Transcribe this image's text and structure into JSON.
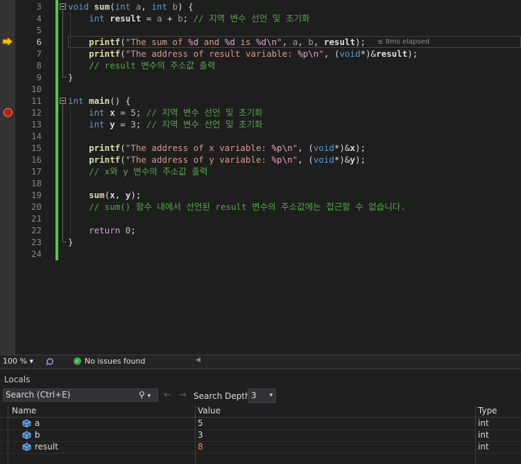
{
  "editor": {
    "lines": [
      {
        "n": "3",
        "html": "<span class='kw'>void</span> <span class='fn'>sum</span>(<span class='kw'>int</span> <span class='pm'>a</span>, <span class='kw'>int</span> <span class='pm'>b</span>) {"
      },
      {
        "n": "4",
        "html": "    <span class='kw'>int</span> <span class='bold'>result</span> = <span class='pm'>a</span> + <span class='pm'>b</span>; <span class='cm'>// 지역 변수 선언 및 초기화</span>"
      },
      {
        "n": "5",
        "html": ""
      },
      {
        "n": "6",
        "html": "    <span class='fn'>printf</span>(<span class='str'>\"The sum of </span><span class='fmt'>%d</span><span class='str'> and </span><span class='fmt'>%d</span><span class='str'> is </span><span class='fmt'>%d\\n</span><span class='str'>\"</span>, <span class='pm'>a</span>, <span class='pm'>b</span>, <span class='bold'>result</span>);"
      },
      {
        "n": "7",
        "html": "    <span class='fn'>printf</span>(<span class='str'>\"The address of result variable: </span><span class='fmt'>%p\\n</span><span class='str'>\"</span>, (<span class='kw'>void</span>*)&amp;<span class='bold'>result</span>);"
      },
      {
        "n": "8",
        "html": "    <span class='cm'>// result 변수의 주소값 출력</span>"
      },
      {
        "n": "9",
        "html": "}"
      },
      {
        "n": "10",
        "html": ""
      },
      {
        "n": "11",
        "html": "<span class='kw'>int</span> <span class='fn'>main</span>() {"
      },
      {
        "n": "12",
        "html": "    <span class='kw'>int</span> <span class='bold'>x</span> = <span class='num'>5</span>; <span class='cm'>// 지역 변수 선언 및 초기화</span>"
      },
      {
        "n": "13",
        "html": "    <span class='kw'>int</span> <span class='bold'>y</span> = <span class='num'>3</span>; <span class='cm'>// 지역 변수 선언 및 초기화</span>"
      },
      {
        "n": "14",
        "html": ""
      },
      {
        "n": "15",
        "html": "    <span class='fn'>printf</span>(<span class='str'>\"The address of x variable: </span><span class='fmt'>%p\\n</span><span class='str'>\"</span>, (<span class='kw'>void</span>*)&amp;<span class='bold'>x</span>);"
      },
      {
        "n": "16",
        "html": "    <span class='fn'>printf</span>(<span class='str'>\"The address of y variable: </span><span class='fmt'>%p\\n</span><span class='str'>\"</span>, (<span class='kw'>void</span>*)&amp;<span class='bold'>y</span>);"
      },
      {
        "n": "17",
        "html": "    <span class='cm'>// x와 y 변수의 주소값 출력</span>"
      },
      {
        "n": "18",
        "html": ""
      },
      {
        "n": "19",
        "html": "    <span class='fn'>sum</span>(<span class='bold'>x</span>, <span class='bold'>y</span>);"
      },
      {
        "n": "20",
        "html": "    <span class='cm'>// sum() 함수 내에서 선언된 result 변수의 주소값에는 접근할 수 없습니다.</span>"
      },
      {
        "n": "21",
        "html": ""
      },
      {
        "n": "22",
        "html": "    <span class='ctl'>return</span> <span class='num'>0</span>;"
      },
      {
        "n": "23",
        "html": "}"
      },
      {
        "n": "24",
        "html": ""
      }
    ],
    "current_line": "6",
    "breakpoint_line": "12",
    "elapsed": "≤ 8ms elapsed"
  },
  "statusbar": {
    "zoom": "100 %",
    "zoom_arrow": "▾",
    "issues": "No issues found",
    "check_glyph": "✓",
    "scroll_left": "◀"
  },
  "locals": {
    "title": "Locals",
    "search_placeholder": "Search (Ctrl+E)",
    "search_glyph": "⚲",
    "search_arrow": "▾",
    "back_glyph": "←",
    "forward_glyph": "→",
    "depth_label": "Search Depth:",
    "depth_value": "3",
    "depth_arrow": "▾",
    "columns": {
      "name": "Name",
      "value": "Value",
      "type": "Type"
    },
    "rows": [
      {
        "name": "a",
        "value": "5",
        "type": "int",
        "changed": false
      },
      {
        "name": "b",
        "value": "3",
        "type": "int",
        "changed": false
      },
      {
        "name": "result",
        "value": "8",
        "type": "int",
        "changed": true
      }
    ],
    "changed_color": "#f48771",
    "normal_color": "#dcdcdc",
    "icon_name": "variable-icon"
  }
}
